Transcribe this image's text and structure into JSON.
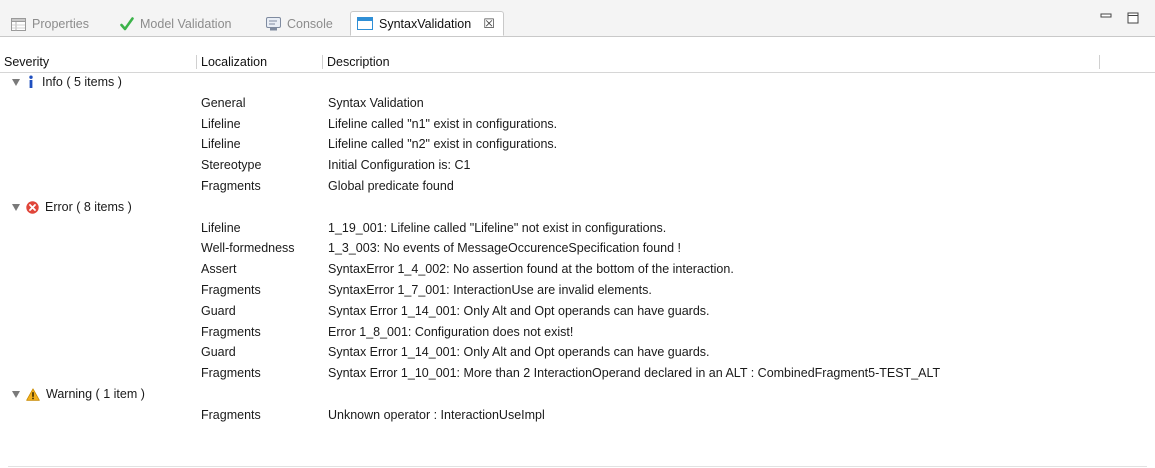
{
  "tabs": [
    {
      "label": "Properties",
      "icon": "properties-icon",
      "active": false
    },
    {
      "label": "Model Validation",
      "icon": "checkmark-icon",
      "active": false
    },
    {
      "label": "Console",
      "icon": "console-icon",
      "active": false
    },
    {
      "label": "SyntaxValidation",
      "icon": "view-icon",
      "active": true,
      "close_glyph": "☒"
    }
  ],
  "columns": {
    "severity": "Severity",
    "localization": "Localization",
    "description": "Description"
  },
  "groups": [
    {
      "label": "Info ( 5 items )",
      "icon": "info-icon",
      "items": [
        {
          "localization": "General",
          "description": "Syntax Validation"
        },
        {
          "localization": "Lifeline",
          "description": "Lifeline called \"n1\" exist in configurations."
        },
        {
          "localization": "Lifeline",
          "description": "Lifeline called \"n2\" exist in configurations."
        },
        {
          "localization": "Stereotype",
          "description": "Initial Configuration is: C1"
        },
        {
          "localization": "Fragments",
          "description": "Global predicate found"
        }
      ]
    },
    {
      "label": "Error ( 8 items )",
      "icon": "error-icon",
      "items": [
        {
          "localization": "Lifeline",
          "description": "1_19_001: Lifeline called \"Lifeline\" not exist in configurations."
        },
        {
          "localization": "Well-formedness",
          "description": "1_3_003: No events of MessageOccurenceSpecification found !"
        },
        {
          "localization": "Assert",
          "description": "SyntaxError 1_4_002: No assertion found at the bottom of the interaction."
        },
        {
          "localization": "Fragments",
          "description": "SyntaxError 1_7_001: InteractionUse are invalid elements."
        },
        {
          "localization": "Guard",
          "description": "Syntax Error 1_14_001: Only Alt and Opt operands can have guards."
        },
        {
          "localization": "Fragments",
          "description": "Error 1_8_001: Configuration does not exist!"
        },
        {
          "localization": "Guard",
          "description": "Syntax Error 1_14_001: Only Alt and Opt operands can have guards."
        },
        {
          "localization": "Fragments",
          "description": "Syntax Error 1_10_001: More than 2 InteractionOperand declared in an ALT : CombinedFragment5-TEST_ALT"
        }
      ]
    },
    {
      "label": "Warning ( 1 item )",
      "icon": "warning-icon",
      "items": [
        {
          "localization": "Fragments",
          "description": "Unknown operator : InteractionUseImpl"
        }
      ]
    }
  ],
  "colors": {
    "info": "#1f4fbf",
    "error": "#e0463a",
    "warning": "#f2b01e",
    "check": "#3cb34a",
    "active_tab_icon": "#2f8fd6"
  }
}
